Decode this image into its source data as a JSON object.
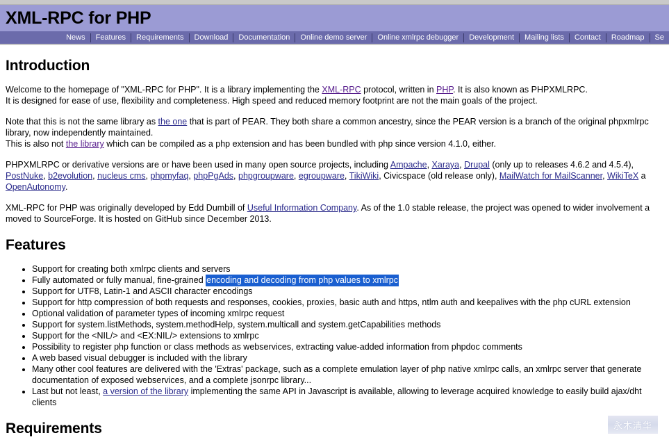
{
  "header": {
    "title": "XML-RPC for PHP"
  },
  "nav": {
    "items": [
      {
        "label": "News"
      },
      {
        "label": "Features"
      },
      {
        "label": "Requirements"
      },
      {
        "label": "Download"
      },
      {
        "label": "Documentation"
      },
      {
        "label": "Online demo server"
      },
      {
        "label": "Online xmlrpc debugger"
      },
      {
        "label": "Development"
      },
      {
        "label": "Mailing lists"
      },
      {
        "label": "Contact"
      },
      {
        "label": "Roadmap"
      },
      {
        "label": "Se"
      }
    ]
  },
  "intro": {
    "heading": "Introduction",
    "p1_a": "Welcome to the homepage of \"XML-RPC for PHP\". It is a library implementing the ",
    "p1_link1": "XML-RPC",
    "p1_b": " protocol, written in ",
    "p1_link2": "PHP",
    "p1_c": ". It is also known as PHPXMLRPC.",
    "p1_line2": "It is designed for ease of use, flexibility and completeness. High speed and reduced memory footprint are not the main goals of the project.",
    "p2_a": "Note that this is not the same library as ",
    "p2_link1": "the one",
    "p2_b": " that is part of PEAR. They both share a common ancestry, since the PEAR version is a branch of the original phpxmlrpc",
    "p2_line2": "library, now independently maintained.",
    "p2_line3_a": "This is also not ",
    "p2_link2": "the library",
    "p2_line3_b": " which can be compiled as a php extension and has been bundled with php since version 4.1.0, either.",
    "p3_a": "PHPXMLRPC or derivative versions are or have been used in many open source projects, including ",
    "p3_projects_row1": [
      {
        "label": "Ampache",
        "link": true
      },
      {
        "label": ", ",
        "link": false
      },
      {
        "label": "Xaraya",
        "link": true
      },
      {
        "label": ", ",
        "link": false
      },
      {
        "label": "Drupal",
        "link": true
      },
      {
        "label": " (only up to releases 4.6.2 and 4.5.4),",
        "link": false
      }
    ],
    "p3_projects_row2": [
      {
        "label": "PostNuke",
        "link": true
      },
      {
        "label": ", ",
        "link": false
      },
      {
        "label": "b2evolution",
        "link": true
      },
      {
        "label": ", ",
        "link": false
      },
      {
        "label": "nucleus cms",
        "link": true
      },
      {
        "label": ", ",
        "link": false
      },
      {
        "label": "phpmyfaq",
        "link": true
      },
      {
        "label": ", ",
        "link": false
      },
      {
        "label": "phpPgAds",
        "link": true
      },
      {
        "label": ", ",
        "link": false
      },
      {
        "label": "phpgroupware",
        "link": true
      },
      {
        "label": ", ",
        "link": false
      },
      {
        "label": "egroupware",
        "link": true
      },
      {
        "label": ", ",
        "link": false
      },
      {
        "label": "TikiWiki",
        "link": true
      },
      {
        "label": ", Civicspace (old release only), ",
        "link": false
      },
      {
        "label": "MailWatch for MailScanner",
        "link": true
      },
      {
        "label": ", ",
        "link": false
      },
      {
        "label": "WikiTeX",
        "link": true
      },
      {
        "label": " a",
        "link": false
      }
    ],
    "p3_projects_row3": [
      {
        "label": "OpenAutonomy",
        "link": true
      },
      {
        "label": ".",
        "link": false
      }
    ],
    "p4_a": "XML-RPC for PHP was originally developed by Edd Dumbill of ",
    "p4_link": "Useful Information Company",
    "p4_b": ". As of the 1.0 stable release, the project was opened to wider involvement a",
    "p4_line2": "moved to SourceForge. It is hosted on GitHub since December 2013."
  },
  "features": {
    "heading": "Features",
    "items": [
      {
        "text": "Support for creating both xmlrpc clients and servers"
      },
      {
        "prefix": "Fully automated or fully manual, fine-grained ",
        "selected": "encoding and decoding from php values to xmlrpc"
      },
      {
        "text": "Support for UTF8, Latin-1 and ASCII character encodings"
      },
      {
        "text": "Support for http compression of both requests and responses, cookies, proxies, basic auth and https, ntlm auth and keepalives with the php cURL extension"
      },
      {
        "text": "Optional validation of parameter types of incoming xmlrpc request"
      },
      {
        "text": "Support for system.listMethods, system.methodHelp, system.multicall and system.getCapabilities methods"
      },
      {
        "text": "Support for the <NIL/> and <EX:NIL/> extensions to xmlrpc"
      },
      {
        "text": "Possibility to register php function or class methods as webservices, extracting value-added information from phpdoc comments"
      },
      {
        "text": "A web based visual debugger is included with the library"
      },
      {
        "text": "Many other cool features are delivered with the 'Extras' package, such as a complete emulation layer of php native xmlrpc calls, an xmlrpc server that generate"
      },
      {
        "text": "documentation of exposed webservices, and a complete jsonrpc library...",
        "continuation": true
      },
      {
        "prefix": "Last but not least, ",
        "link": "a version of the library",
        "suffix": " implementing the same API in Javascript is available, allowing to leverage acquired knowledge to easily build ajax/dht"
      },
      {
        "text": "clients",
        "continuation": true
      }
    ]
  },
  "requirements": {
    "heading": "Requirements"
  },
  "watermark": {
    "text": "永木清华"
  },
  "colors": {
    "header_bg": "#9b9bd4",
    "nav_bg": "#6b6bab",
    "selection_bg": "#1a5fd0",
    "link": "#551a8b"
  }
}
